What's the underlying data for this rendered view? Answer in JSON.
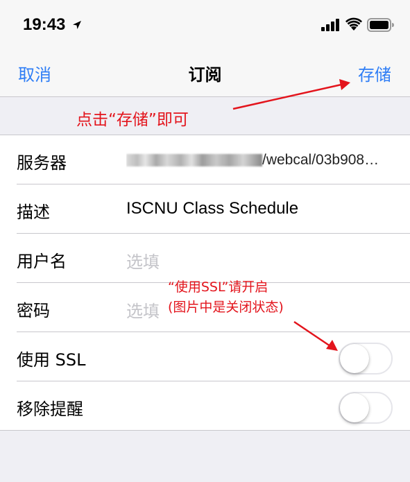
{
  "status_bar": {
    "time": "19:43",
    "icons": [
      "location-arrow-icon",
      "signal-bars-icon",
      "wifi-icon",
      "battery-icon"
    ]
  },
  "nav": {
    "cancel_label": "取消",
    "title": "订阅",
    "save_label": "存储",
    "accent_color": "#2f7ef6"
  },
  "annotations": {
    "save_hint": "点击“存储”即可",
    "ssl_hint_line1": "“使用SSL”请开启",
    "ssl_hint_line2": "(图片中是关闭状态)",
    "color": "#e3141c"
  },
  "form": {
    "rows": [
      {
        "label": "服务器",
        "value": "/webcal/03b908…"
      },
      {
        "label": "描述",
        "value": "ISCNU Class Schedule"
      },
      {
        "label": "用户名",
        "placeholder": "选填"
      },
      {
        "label": "密码",
        "placeholder": "选填"
      },
      {
        "label": "使用 SSL",
        "toggle_on": false
      },
      {
        "label": "移除提醒",
        "toggle_on": false
      }
    ]
  }
}
